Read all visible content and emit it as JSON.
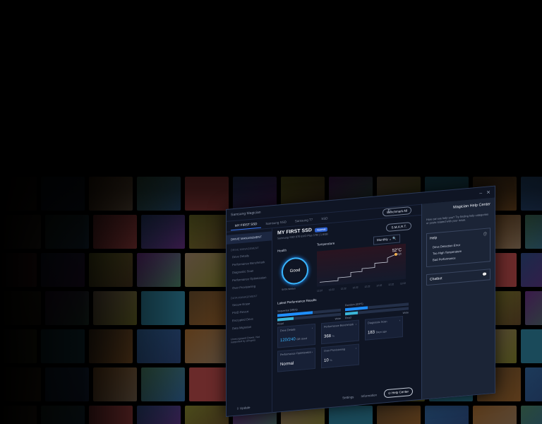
{
  "window": {
    "title": "Samsung Magician"
  },
  "tabs": [
    "MY FIRST SSD",
    "Samsung SSD",
    "Samsung T7",
    "SSD"
  ],
  "header": {
    "benchmark_label": "Benchmark All",
    "smart_label": "S.M.A.R.T."
  },
  "sidebar": {
    "active": "DRIVE MANAGEMENT",
    "section1_head": "DRIVE MANAGEMENT",
    "items1": [
      "Drive Details",
      "Performance Benchmark",
      "Diagnostic Scan",
      "Performance Optimization",
      "Over Provisioning"
    ],
    "section2_head": "DATA MANAGEMENT",
    "items2": [
      "Secure Erase",
      "PSID Revert",
      "Encrypted Drive",
      "Data Migration"
    ],
    "note": "Unrecognized Drives. Not supported by all types",
    "update_label": "Update"
  },
  "drive": {
    "name": "MY FIRST SSD",
    "badge": "Normal",
    "subtitle": "Samsung SSD 970 EVO Plus 1TB  |  1.6GB",
    "health_label": "Health",
    "health_value": "Good",
    "health_sub": "SATA Written",
    "temperature_label": "Temperature",
    "temp_value": "52°C",
    "temp_sub": "High",
    "range_label": "Monthly",
    "ticks": [
      "12.22",
      "12.22",
      "12.22",
      "12.22",
      "12.22",
      "12.22",
      "12.22",
      "12.22"
    ]
  },
  "performance": {
    "title": "Latest Performance Results",
    "sequential_label": "Sequential (MB/s)",
    "random_label": "Random (IOPS)",
    "read_label": "Read",
    "write_label": "Write",
    "seq_read_pct": 0.55,
    "seq_write_pct": 0.25,
    "rand_read_pct": 0.35,
    "rand_write_pct": 0.2
  },
  "cards": [
    {
      "title": "Drive Details",
      "value": "120/240",
      "unit": "GB Used"
    },
    {
      "title": "Performance Benchmark",
      "value": "368",
      "unit": "%"
    },
    {
      "title": "Diagnostic Scan",
      "value": "183",
      "unit": "Days ago"
    },
    {
      "title": "Performance Optimization",
      "value": "Normal",
      "unit": ""
    },
    {
      "title": "Over Provisioning",
      "value": "10",
      "unit": "%"
    }
  ],
  "footer": {
    "settings": "Settings",
    "information": "Information",
    "help_center": "Help Center"
  },
  "help": {
    "title": "Magician Help Center",
    "question": "How can we help you? Try finding help categories or posts related with your issue.",
    "section": "Help",
    "items": [
      "Drive Detection Error",
      "Too High Temperature",
      "Bad Performance"
    ],
    "chatbot": "Chatbot"
  },
  "colors": {
    "accent": "#3b7bff",
    "gauge": "#39b6ff",
    "read": "#1f8fff",
    "write": "#3bb6d8"
  }
}
